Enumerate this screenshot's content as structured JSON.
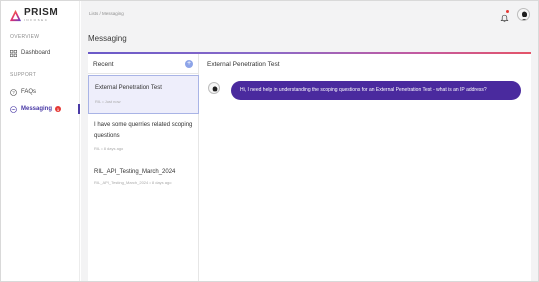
{
  "app": {
    "logo_word": "PRISM",
    "logo_sub": "INFOSEC"
  },
  "sidebar": {
    "overview_label": "OVERVIEW",
    "support_label": "SUPPORT",
    "items": [
      {
        "label": "Dashboard",
        "icon": "grid-icon"
      },
      {
        "label": "FAQs",
        "icon": "help-circle-icon"
      },
      {
        "label": "Messaging",
        "icon": "chat-icon",
        "badge": "1",
        "active": true
      }
    ]
  },
  "header": {
    "breadcrumb": "Lists / Messaging"
  },
  "page": {
    "title": "Messaging"
  },
  "conversations": {
    "header": "Recent",
    "add_label": "+",
    "items": [
      {
        "title": "External Penetration Test",
        "meta": "RIL • Just now",
        "selected": true
      },
      {
        "title": "I have some querries related scoping questions",
        "meta": "RIL • 8 days ago",
        "selected": false
      },
      {
        "title": "RIL_API_Testing_March_2024",
        "meta": "RIL_API_Testing_March_2024 • 8 days ago",
        "selected": false
      }
    ]
  },
  "chat": {
    "title": "External Penetration Test",
    "messages": [
      {
        "text": "Hi, I need help in understanding the scoping questions for an External Penetration Test - what is an IP address?"
      }
    ]
  },
  "colors": {
    "accent": "#4a2a9e",
    "active_nav": "#4a3aa6",
    "badge": "#e53935",
    "add_button": "#8da4e8"
  }
}
